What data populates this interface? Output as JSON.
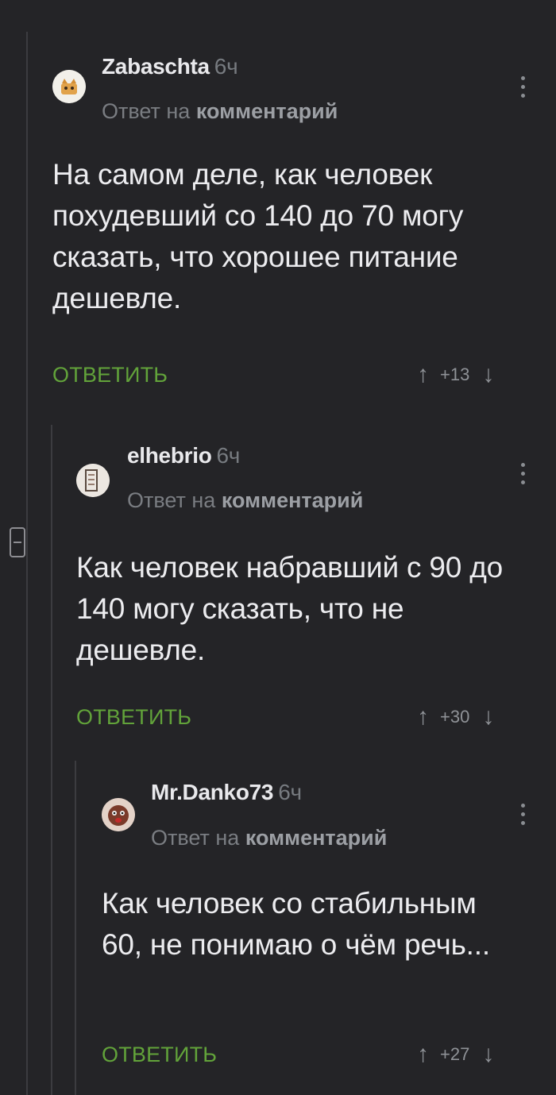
{
  "comments": [
    {
      "author": "Zabaschta",
      "time": "6ч",
      "reply_prefix": "Ответ на",
      "reply_target": "комментарий",
      "text": "На самом деле, как человек похудевший со 140 до 70 могу сказать, что хорошее питание дешевле.",
      "reply_label": "ОТВЕТИТЬ",
      "score": "+13"
    },
    {
      "author": "elhebrio",
      "time": "6ч",
      "reply_prefix": "Ответ на",
      "reply_target": "комментарий",
      "text": "Как человек набравший с 90 до 140 могу сказать, что не дешевле.",
      "reply_label": "ОТВЕТИТЬ",
      "score": "+30"
    },
    {
      "author": "Mr.Danko73",
      "time": "6ч",
      "reply_prefix": "Ответ на",
      "reply_target": "комментарий",
      "text": "Как человек со стабильным 60, не понимаю о чём речь...",
      "reply_label": "ОТВЕТИТЬ",
      "score": "+27"
    }
  ],
  "icons": {
    "upvote": "↑",
    "downvote": "↓"
  },
  "colors": {
    "background": "#242427",
    "accent_green": "#62a33a",
    "muted": "#7a7d82"
  }
}
